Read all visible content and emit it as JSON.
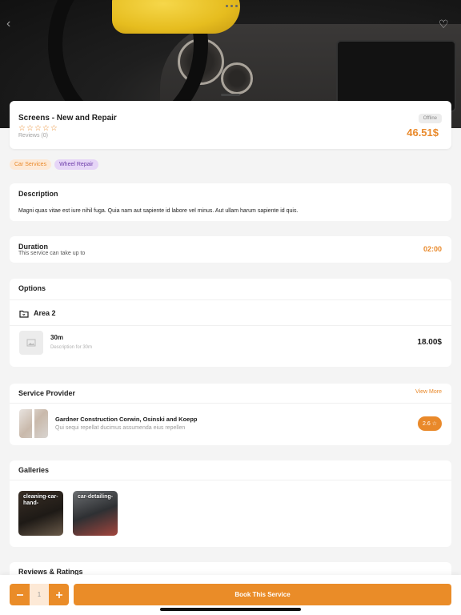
{
  "header": {
    "title": "Screens - New and Repair",
    "reviews": "Reviews (0)",
    "status": "Offline",
    "price": "46.51$",
    "rating_stars": 0
  },
  "categories": [
    "Car Services",
    "Wheel Repair"
  ],
  "description": {
    "title": "Description",
    "text": "Magni quas vitae est iure nihil fuga. Quia nam aut sapiente id labore vel minus. Aut ullam harum sapiente id quis."
  },
  "duration": {
    "title": "Duration",
    "subtitle": "This service can take up to",
    "value": "02:00"
  },
  "options": {
    "title": "Options",
    "group": "Area 2",
    "item": {
      "name": "30m",
      "description": "Description for 30m",
      "price": "18.00$"
    }
  },
  "provider": {
    "title": "Service Provider",
    "view_more": "View More",
    "name": "Gardner Construction Corwin, Osinski and Koepp",
    "description": "Qui sequi repellat ducimus assumenda eius repellen",
    "rating": "2.6"
  },
  "galleries": {
    "title": "Galleries",
    "items": [
      "cleaning-car-hand-",
      "car-detailing-"
    ]
  },
  "reviews_section": {
    "title": "Reviews & Ratings"
  },
  "booking": {
    "quantity": "1",
    "button": "Book This Service"
  },
  "colors": {
    "accent": "#ea8c28",
    "chip_purple": "#6d3da9"
  }
}
